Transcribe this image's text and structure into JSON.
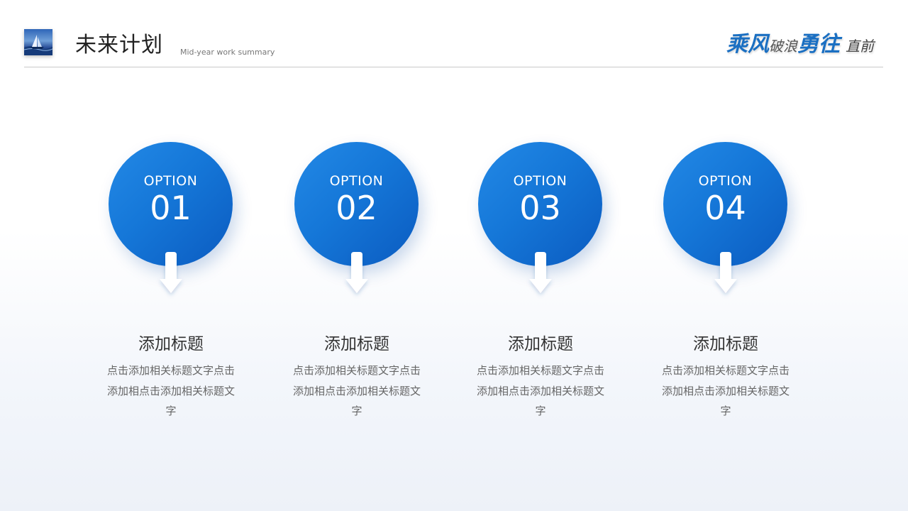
{
  "header": {
    "title": "未来计划",
    "subtitle": "Mid-year work summary",
    "slogan": {
      "part1": "乘风",
      "part2": "破浪",
      "part3": "勇往",
      "part4": "直前"
    }
  },
  "colors": {
    "accent": "#1577d8",
    "accent_dark": "#0b5bc0",
    "slogan_blue": "#1a6fc2"
  },
  "options": [
    {
      "label": "OPTION",
      "number": "01",
      "title": "添加标题",
      "description": "点击添加相关标题文字点击添加相点击添加相关标题文字"
    },
    {
      "label": "OPTION",
      "number": "02",
      "title": "添加标题",
      "description": "点击添加相关标题文字点击添加相点击添加相关标题文字"
    },
    {
      "label": "OPTION",
      "number": "03",
      "title": "添加标题",
      "description": "点击添加相关标题文字点击添加相点击添加相关标题文字"
    },
    {
      "label": "OPTION",
      "number": "04",
      "title": "添加标题",
      "description": "点击添加相关标题文字点击添加相点击添加相关标题文字"
    }
  ]
}
